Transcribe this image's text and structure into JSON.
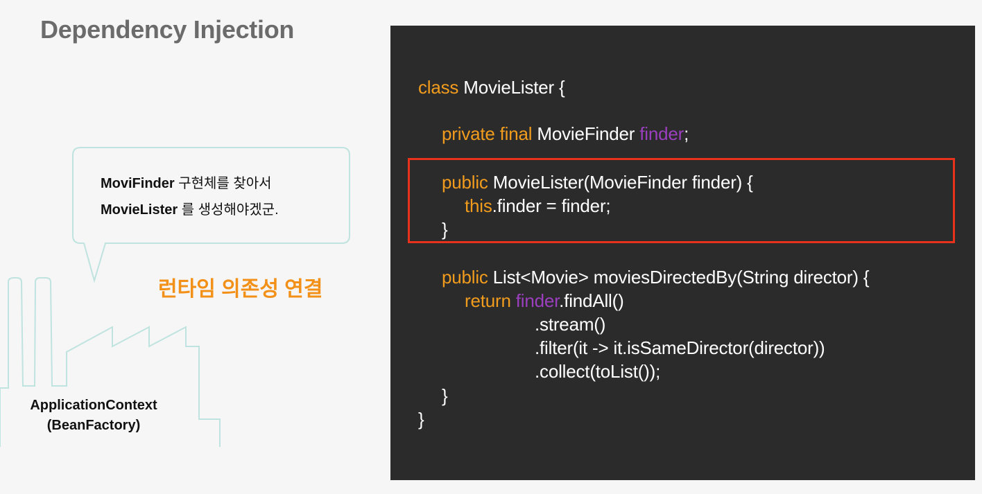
{
  "slide": {
    "title": "Dependency Injection",
    "bubble": {
      "line1_bold": "MoviFinder",
      "line1_rest": " 구현체를 찾아서",
      "line2_bold": "MovieLister",
      "line2_rest": " 를 생성해야겠군."
    },
    "runtime_label": "런타임 의존성 연결",
    "factory": {
      "line1": "ApplicationContext",
      "line2": "(BeanFactory)"
    }
  },
  "code": {
    "l1_kw": "class",
    "l1_rest": " MovieLister {",
    "l2_kw": "private final",
    "l2_type": " MovieFinder ",
    "l2_field": "finder",
    "l2_end": ";",
    "l3_kw": "public",
    "l3_rest": " MovieLister(MovieFinder finder) {",
    "l4_kw": "this",
    "l4_rest": ".finder = finder;",
    "l5": "}",
    "l6_kw": "public",
    "l6_rest": " List<Movie> moviesDirectedBy(String director) {",
    "l7_kw": "return",
    "l7_sp": " ",
    "l7_field": "finder",
    "l7_rest": ".findAll()",
    "l8": ".stream()",
    "l9": ".filter(it -> it.isSameDirector(director))",
    "l10": ".collect(toList());",
    "l11": "}",
    "l12": "}"
  },
  "colors": {
    "keyword": "#f29c1e",
    "field": "#9b3fbf",
    "highlight_border": "#e8321c",
    "code_background": "#2b2b2b",
    "runtime_label": "#f29018",
    "outline": "#bfe3df"
  }
}
